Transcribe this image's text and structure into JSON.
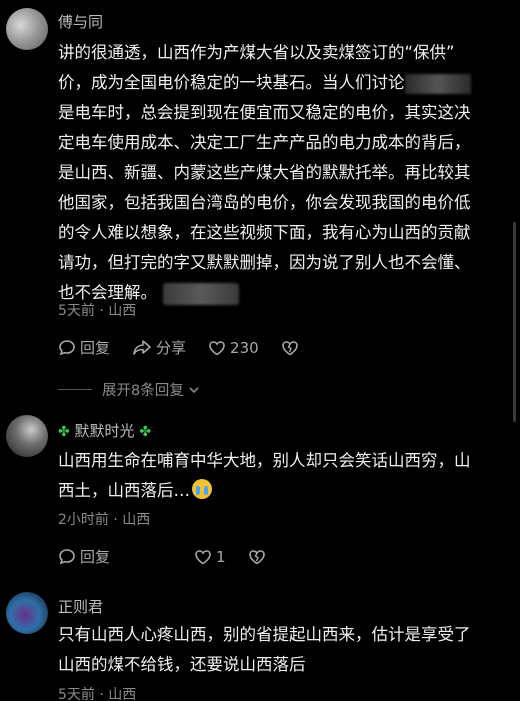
{
  "comments": [
    {
      "username": "傅与同",
      "lines": [
        "讲的很通透，山西作为产煤大省以及卖煤签订的“保供”",
        "价，成为全国电价稳定的一块基石。当人们讨论",
        "是电车时，总会提到现在便宜而又稳定的电价，其实这决",
        "定电车使用成本、决定工厂生产产品的电力成本的背后，",
        "是山西、新疆、内蒙这些产煤大省的默默托举。再比较其",
        "他国家，包括我国台湾岛的电价，你会发现我国的电价低",
        "的令人难以想象，在这些视频下面，我有心为山西的贡献",
        "请功，但打完的字又默默删掉，因为说了别人也不会懂、",
        "也不会理解。"
      ],
      "meta": "5天前 · 山西",
      "reply_label": "回复",
      "share_label": "分享",
      "like_count": "230",
      "expand_label": "展开8条回复"
    },
    {
      "username": "默默时光",
      "clover_left": "✤",
      "clover_right": "✤",
      "lines": [
        "山西用生命在哺育中华大地，别人却只会笑话山西穷，山",
        "西土，山西落后…"
      ],
      "meta": "2小时前 · 山西",
      "reply_label": "回复",
      "like_count": "1"
    },
    {
      "username": "正则君",
      "lines": [
        "只有山西人心疼山西，别的省提起山西来，估计是享受了",
        "山西的煤不给钱，还要说山西落后"
      ],
      "meta": "5天前 · 山西"
    }
  ],
  "icons": {
    "reply": "comment-bubble-icon",
    "share": "share-arrow-icon",
    "like": "heart-icon",
    "dislike": "broken-heart-icon",
    "expand": "chevron-down-icon"
  },
  "colors": {
    "background": "#000000",
    "text": "#f0f0f0",
    "muted": "#8a8a8a",
    "clover": "#3fc35a"
  }
}
